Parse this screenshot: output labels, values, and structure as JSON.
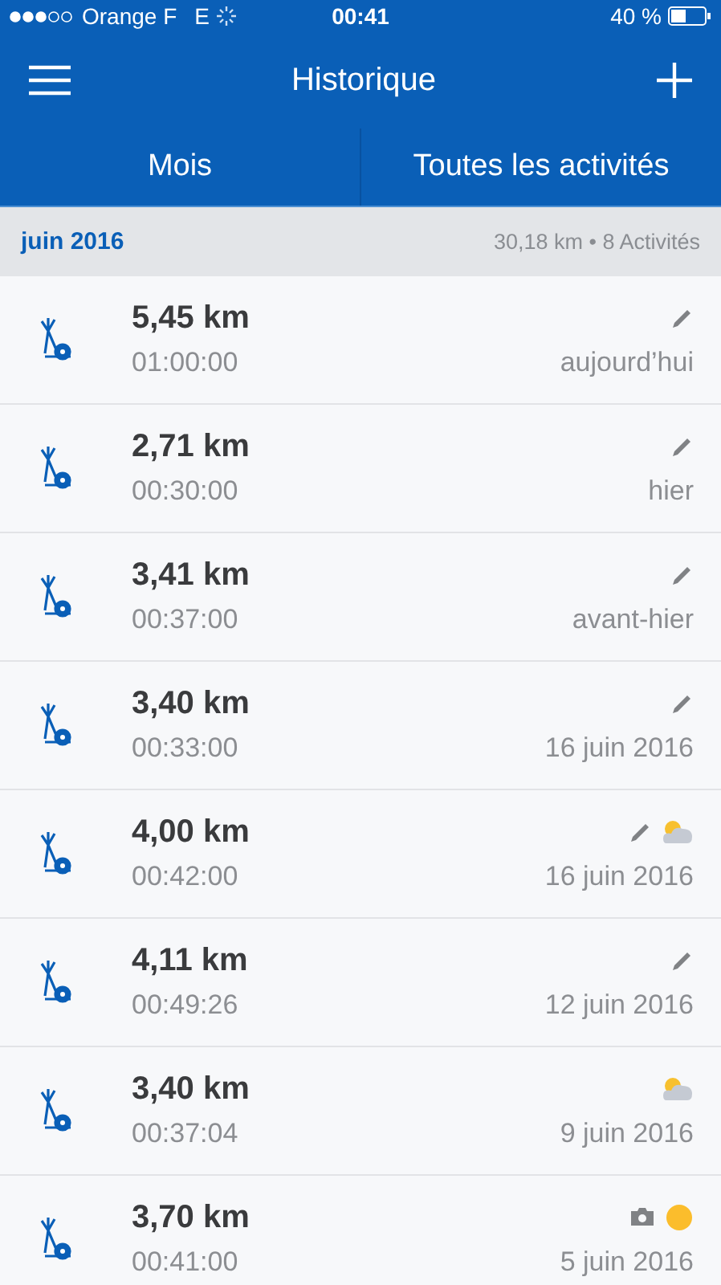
{
  "status_bar": {
    "carrier": "Orange F",
    "network": "E",
    "time": "00:41",
    "battery": "40 %"
  },
  "nav": {
    "title": "Historique"
  },
  "tabs": [
    {
      "label": "Mois"
    },
    {
      "label": "Toutes les activités"
    }
  ],
  "section": {
    "title": "juin 2016",
    "summary": "30,18 km • 8 Activités"
  },
  "activities": [
    {
      "distance": "5,45 km",
      "duration": "01:00:00",
      "date": "aujourd’hui",
      "badges": [
        {
          "kind": "edit"
        }
      ]
    },
    {
      "distance": "2,71 km",
      "duration": "00:30:00",
      "date": "hier",
      "badges": [
        {
          "kind": "edit"
        }
      ]
    },
    {
      "distance": "3,41 km",
      "duration": "00:37:00",
      "date": "avant-hier",
      "badges": [
        {
          "kind": "edit"
        }
      ]
    },
    {
      "distance": "3,40 km",
      "duration": "00:33:00",
      "date": "16 juin 2016",
      "badges": [
        {
          "kind": "edit"
        }
      ]
    },
    {
      "distance": "4,00 km",
      "duration": "00:42:00",
      "date": "16 juin 2016",
      "badges": [
        {
          "kind": "edit"
        },
        {
          "kind": "cloudy"
        }
      ]
    },
    {
      "distance": "4,11 km",
      "duration": "00:49:26",
      "date": "12 juin 2016",
      "badges": [
        {
          "kind": "edit"
        }
      ]
    },
    {
      "distance": "3,40 km",
      "duration": "00:37:04",
      "date": "9 juin 2016",
      "badges": [
        {
          "kind": "cloudy"
        }
      ]
    },
    {
      "distance": "3,70 km",
      "duration": "00:41:00",
      "date": "5 juin 2016",
      "badges": [
        {
          "kind": "camera"
        },
        {
          "kind": "sunny"
        }
      ]
    }
  ]
}
